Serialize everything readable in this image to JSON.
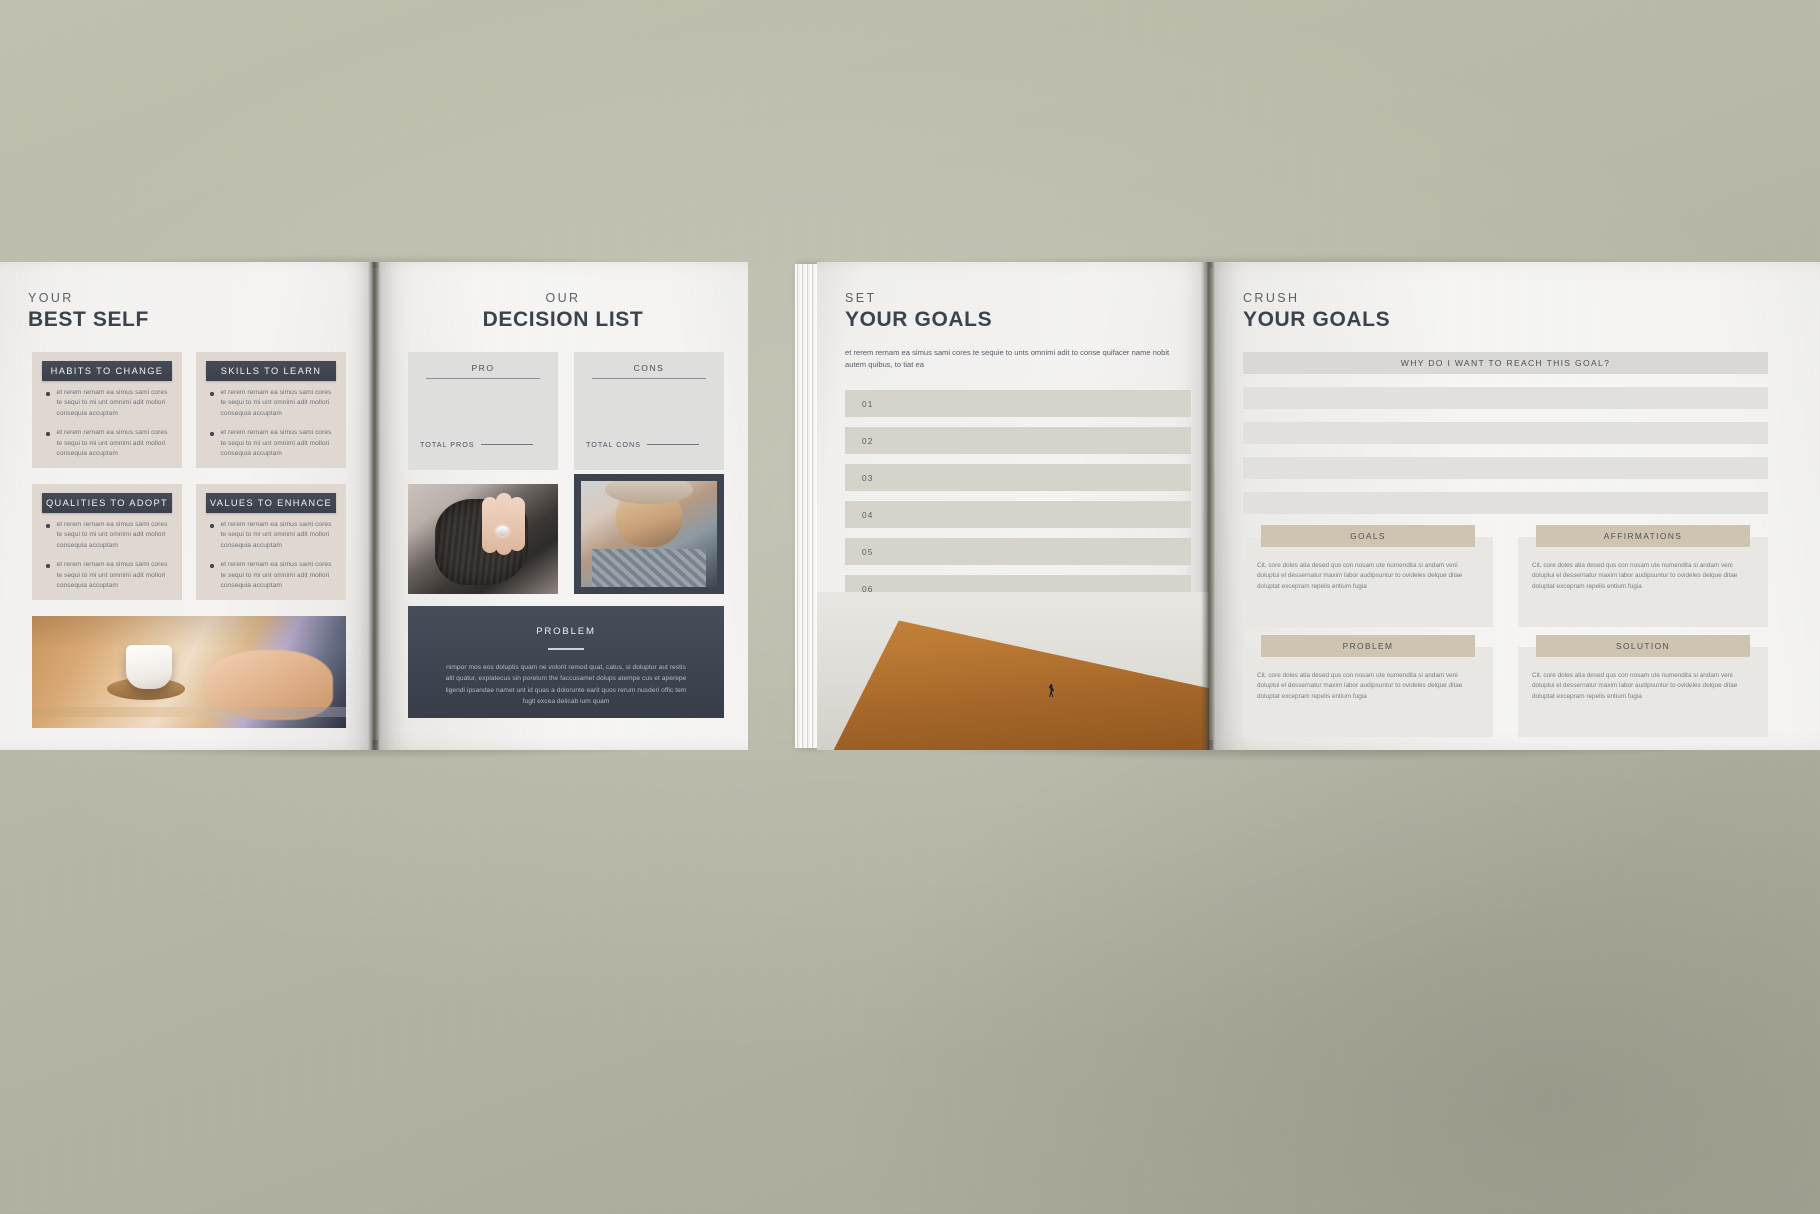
{
  "spread": {
    "description": "Open landscape workbook mockup, two books on a grey-green desk surface"
  },
  "page1": {
    "kicker": "YOUR",
    "title": "BEST SELF",
    "cards": [
      {
        "heading": "HABITS TO CHANGE",
        "items": [
          "et rerem rernam ea simus sami cores te sequi to mi unt omnimi adit mollori consequia accuptam",
          "et rerem rernam ea simus sami cores te sequi to mi unt omnimi adit mollori consequia accuptam"
        ]
      },
      {
        "heading": "SKILLS TO LEARN",
        "items": [
          "et rerem rernam ea simus sami cores te sequi to mi unt omnimi adit mollori consequia accuptam",
          "et rerem rernam ea simus sami cores te sequi to mi unt omnimi adit mollori consequia accuptam"
        ]
      },
      {
        "heading": "QUALITIES TO ADOPT",
        "items": [
          "et rerem rernam ea simus sami cores te sequi to mi unt omnimi adit mollori consequia accuptam",
          "et rerem rernam ea simus sami cores te sequi to mi unt omnimi adit mollori consequia accuptam"
        ]
      },
      {
        "heading": "VALUES TO ENHANCE",
        "items": [
          "et rerem rernam ea simus sami cores te sequi to mi unt omnimi adit mollori consequia accuptam",
          "et rerem rernam ea simus sami cores te sequi to mi unt omnimi adit mollori consequia accuptam"
        ]
      }
    ],
    "photo_alt": "coffee-cup-on-wooden-desk-photo"
  },
  "page2": {
    "kicker": "OUR",
    "title": "DECISION LIST",
    "pro_label": "PRO",
    "cons_label": "CONS",
    "total_pros_label": "TOTAL PROS",
    "total_cons_label": "TOTAL CONS",
    "photo_a_alt": "hand-with-manicured-nails-photo",
    "photo_b_alt": "woman-with-hat-portrait-photo",
    "problem": {
      "title": "PROBLEM",
      "body": "nimpor mos eos doluptis quam ne volorit remod quat, catus, si doluptur aut restis alit quatur, explatecus sin porelum the faccusamet dolups atempe cus et aperepe ligendi ipsandae namet unt id quas a dolorunte earit quos rerum nusderi offic tem fugit excea delicab ium quam"
    }
  },
  "page3": {
    "kicker": "SET",
    "title": "YOUR GOALS",
    "intro": "et rerem rernam ea simus sami cores te sequie to unts omnimi adit to conse quifacer name nobit autem quibus, to tiat ea",
    "rows": [
      "01",
      "02",
      "03",
      "04",
      "05",
      "06"
    ],
    "photo_alt": "runner-on-hill-silhouette-photo"
  },
  "page4": {
    "kicker": "CRUSH",
    "title": "YOUR GOALS",
    "why_label": "WHY DO I WANT TO REACH THIS GOAL?",
    "blank_lines": 4,
    "cards": [
      {
        "label": "GOALS",
        "body": "Cit, core doles atia desed qus con nosam ute numendita si andam veni doluptui el dessernatur maxim labor audipsuntur to ovideles delque ditae doluptat excepram repelis entium fugia"
      },
      {
        "label": "AFFIRMATIONS",
        "body": "Cit, core doles atia desed qus con nosam ute numendita si andam veni doluptui el dessernatur maxim labor audipsuntur to ovideles delque ditae doluptat excepram repelis entium fugia"
      },
      {
        "label": "PROBLEM",
        "body": "Cit, core doles atia desed qus con nosam ute numendita si andam veni doluptui el dessernatur maxim labor audipsuntur to ovideles delque ditae doluptat excepram repelis entium fugia"
      },
      {
        "label": "SOLUTION",
        "body": "Cit, core doles atia desed qus con nosam ute numendita si andam veni doluptui el dessernatur maxim labor audipsuntur to ovideles delque ditae doluptat excepram repelis entium fugia"
      }
    ]
  },
  "colors": {
    "desk": "#bcbaa9",
    "paper": "#f5f4f2",
    "dark_navy": "#3e4450",
    "warm_grey_card": "#ded8d0",
    "cool_grey_box": "#dededd",
    "tan_cap": "#cfc3b2",
    "goal_row": "#d6d3ca",
    "text_dark": "#3d434d",
    "text_muted": "#6f7278"
  }
}
